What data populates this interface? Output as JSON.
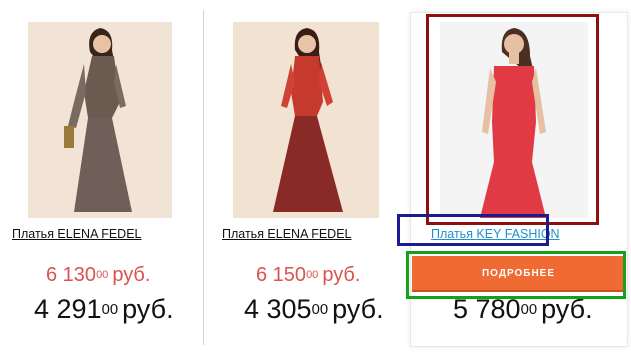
{
  "products": [
    {
      "title": "Платья ELENA FEDEL",
      "old_price_main": "6 130",
      "old_price_cents": "00",
      "new_price_main": "4 291",
      "new_price_cents": "00",
      "currency": "руб."
    },
    {
      "title": "Платья ELENA FEDEL",
      "old_price_main": "6 150",
      "old_price_cents": "00",
      "new_price_main": "4 305",
      "new_price_cents": "00",
      "currency": "руб."
    },
    {
      "title": "Платья KEY FASHION",
      "button_label": "ПОДРОБНЕЕ",
      "new_price_main": "5 780",
      "new_price_cents": "00",
      "currency": "руб."
    }
  ],
  "colors": {
    "old_price": "#d9534f",
    "button": "#f06b34",
    "link": "#1e8fd0",
    "highlight_image": "#8b1010",
    "highlight_title": "#1b1b8f",
    "highlight_button": "#16a11b"
  }
}
